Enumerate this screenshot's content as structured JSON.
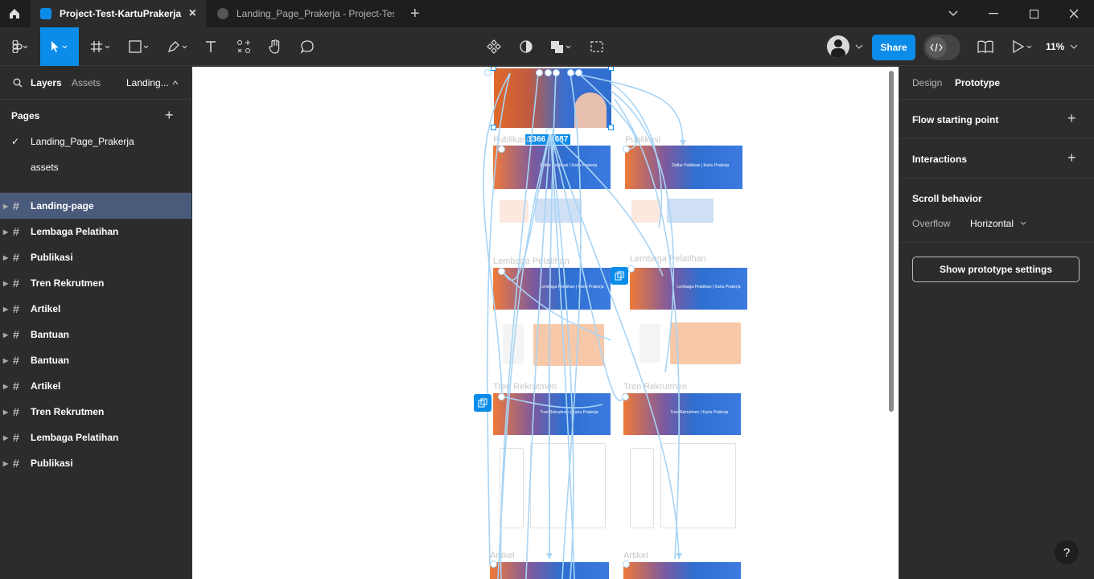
{
  "titlebar": {
    "tabs": [
      {
        "label": "Project-Test-KartuPrakerja",
        "active": true
      },
      {
        "label": "Landing_Page_Prakerja - Project-Test",
        "active": false
      }
    ]
  },
  "toolbar": {
    "share_label": "Share",
    "zoom": "11%"
  },
  "left_panel": {
    "tab_layers": "Layers",
    "tab_assets": "Assets",
    "page_switch": "Landing...",
    "pages_title": "Pages",
    "pages": [
      "Landing_Page_Prakerja",
      "assets"
    ],
    "layers": [
      "Landing-page",
      "Lembaga Pelatihan",
      "Publikasi",
      "Tren Rekrutmen",
      "Artikel",
      "Bantuan",
      "Bantuan",
      "Artikel",
      "Tren Rekrutmen",
      "Lembaga Pelatihan",
      "Publikasi"
    ]
  },
  "right_panel": {
    "tab_design": "Design",
    "tab_prototype": "Prototype",
    "flow_start": "Flow starting point",
    "interactions": "Interactions",
    "scroll_behavior": "Scroll behavior",
    "overflow_label": "Overflow",
    "overflow_value": "Horizontal",
    "show_settings": "Show prototype settings"
  },
  "canvas": {
    "frame_labels": {
      "pub_left": "Publikasi",
      "pub_right": "Publikasi",
      "lem_left": "Lembaga Pelatihan",
      "lem_right": "Lembaga Pelatihan",
      "tren_left": "Tren Rekrutmen",
      "tren_right": "Tren Rekrutmen",
      "art_left": "Artikel",
      "art_right": "Artikel"
    },
    "size_badge": "1366 × 687",
    "hero_texts": {
      "pub": "Daftar Publikasi | Kartu Prakerja",
      "lem": "Lembaga Pelatihan | Kartu Prakerja",
      "tren": "Tren Rekrutmen | Kartu Prakerja"
    }
  },
  "colors": {
    "accent": "#0c8ce9",
    "panel": "#2c2c2c",
    "titlebar": "#1e1e1e",
    "flow_line": "#a8d4f5"
  },
  "help": "?"
}
